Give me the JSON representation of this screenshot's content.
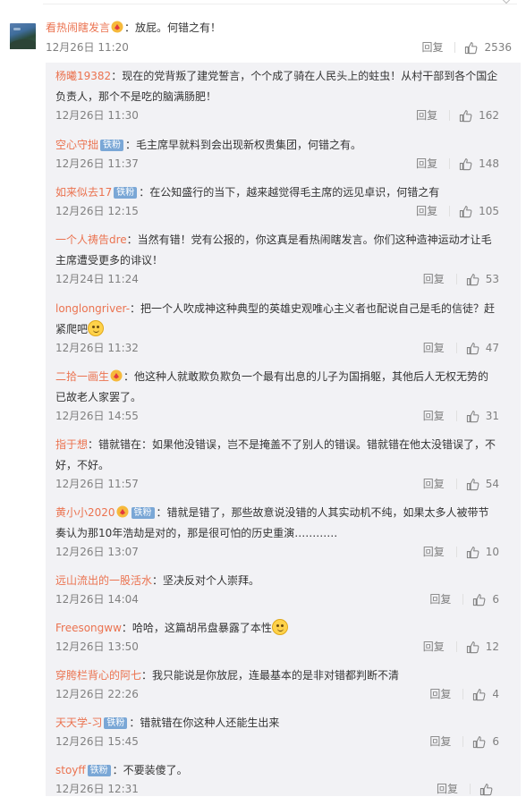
{
  "main_comment": {
    "username": "看热闹瞎发言",
    "text": "：放屁。何错之有！",
    "time": "12月26日 11:20",
    "reply_label": "回复",
    "likes": "2536"
  },
  "replies": [
    {
      "username": "杨曦19382",
      "text": "：现在的党背叛了建党誓言，个个成了骑在人民头上的蛀虫！从村干部到各个国企负责人，那个不是吃的脑满肠肥！",
      "time": "12月26日 11:30",
      "likes": "162"
    },
    {
      "username": "空心守拙",
      "badge": "铁粉",
      "text": "：毛主席早就料到会出现新权贵集团，何错之有。",
      "time": "12月26日 11:37",
      "likes": "148"
    },
    {
      "username": "如来似去17",
      "badge": "铁粉",
      "text": "：在公知盛行的当下，越来越觉得毛主席的远见卓识，何错之有",
      "time": "12月26日 12:15",
      "likes": "105"
    },
    {
      "username": "一个人祷告dre",
      "text": "：当然有错！党有公报的，你这真是看热闹瞎发言。你们这种造神运动才让毛主席遭受更多的诽议！",
      "time": "12月24日 11:24",
      "likes": "53"
    },
    {
      "username": "longlongriver-",
      "text": "：把一个人吹成神这种典型的英雄史观唯心主义者也配说自己是毛的信徒？赶紧爬吧",
      "emoji": true,
      "time": "12月26日 11:32",
      "likes": "47"
    },
    {
      "username": "二拾一画生",
      "vip": true,
      "text": "：他这种人就敢欺负欺负一个最有出息的儿子为国捐躯，其他后人无权无势的已故老人家罢了。",
      "time": "12月26日 14:55",
      "likes": "31"
    },
    {
      "username": "指于想",
      "text": "：错就错在：如果他没错误，岂不是掩盖不了别人的错误。错就错在他太没错误了，不好，不好。",
      "time": "12月26日 11:57",
      "likes": "54"
    },
    {
      "username": "黄小小2020",
      "vip": true,
      "badge": "铁粉",
      "text": "：错就是错了，那些故意说没错的人其实动机不纯，如果太多人被带节奏认为那10年浩劫是对的，那是很可怕的历史重演…………",
      "time": "12月26日 13:07",
      "likes": "10"
    },
    {
      "username": "远山流出的一股活水",
      "text": "：坚决反对个人崇拜。",
      "time": "12月26日 14:04",
      "likes": "6"
    },
    {
      "username": "Freesongww",
      "text": "：哈哈，这篇胡吊盘暴露了本性",
      "emoji": true,
      "time": "12月26日 13:50",
      "likes": "12"
    },
    {
      "username": "穿胯栏背心的阿七",
      "text": "：我只能说是你放屁，连最基本的是非对错都判断不清",
      "time": "12月26日 22:26",
      "likes": "4"
    },
    {
      "username": "天天学-习",
      "badge": "铁粉",
      "text": "：错就错在你这种人还能生出来",
      "time": "12月26日 15:45",
      "likes": "6"
    },
    {
      "username": "stoyff",
      "badge": "铁粉",
      "text": "：不要装傻了。",
      "time": "12月26日 12:31",
      "likes": ""
    }
  ],
  "reply_label": "回复",
  "colors": {
    "username": "#eb7350",
    "reply_bg": "#f2f2f5",
    "meta": "#808080",
    "badge": "#7aa7d6"
  }
}
